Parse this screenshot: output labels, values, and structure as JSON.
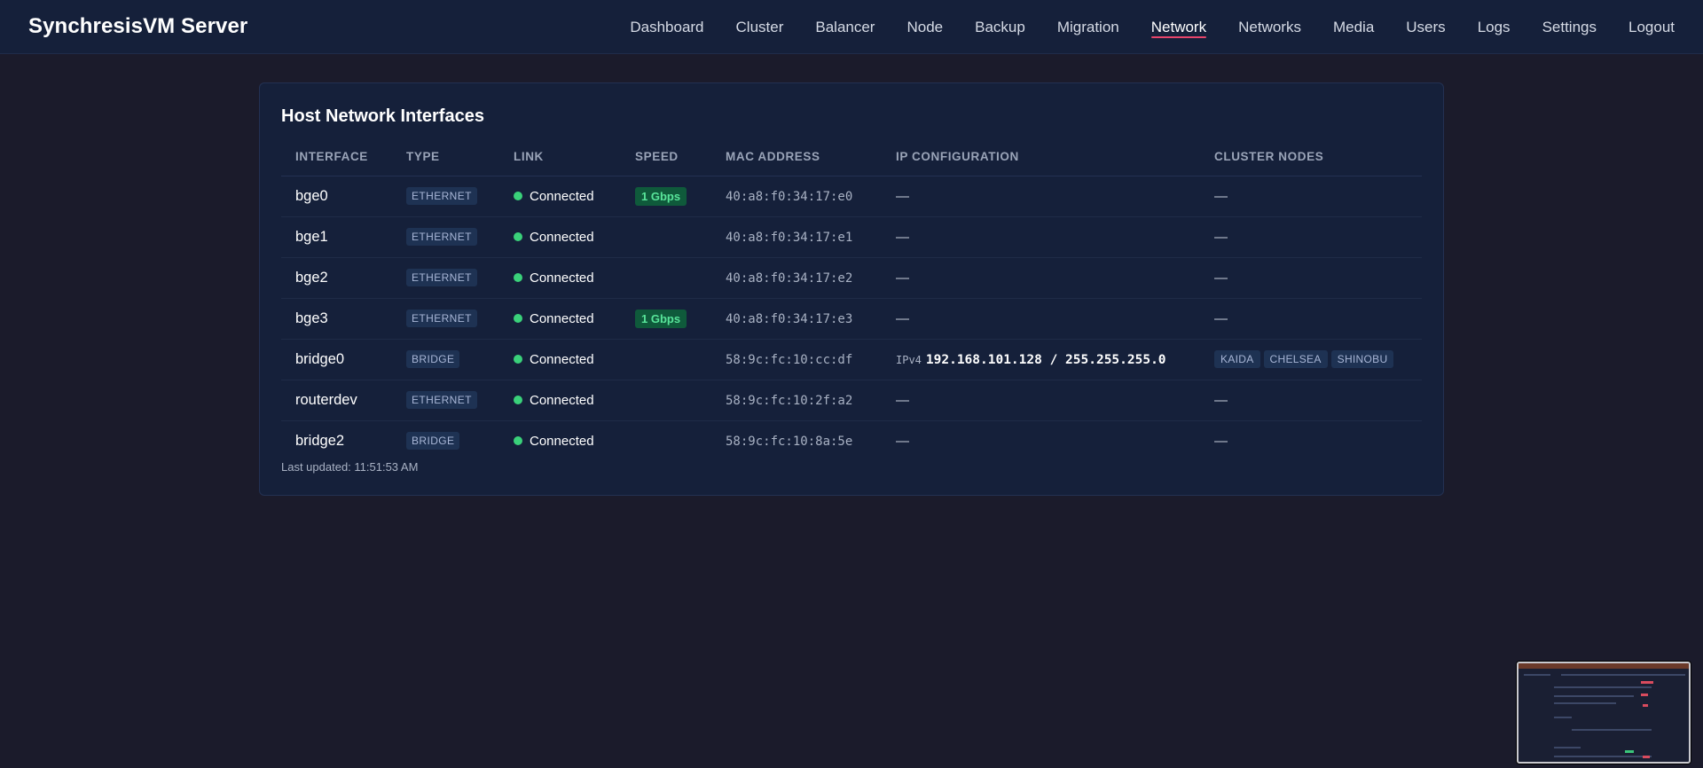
{
  "app": {
    "title": "SynchresisVM Server"
  },
  "nav": {
    "items": [
      {
        "label": "Dashboard",
        "active": false
      },
      {
        "label": "Cluster",
        "active": false
      },
      {
        "label": "Balancer",
        "active": false
      },
      {
        "label": "Node",
        "active": false
      },
      {
        "label": "Backup",
        "active": false
      },
      {
        "label": "Migration",
        "active": false
      },
      {
        "label": "Network",
        "active": true
      },
      {
        "label": "Networks",
        "active": false
      },
      {
        "label": "Media",
        "active": false
      },
      {
        "label": "Users",
        "active": false
      },
      {
        "label": "Logs",
        "active": false
      },
      {
        "label": "Settings",
        "active": false
      },
      {
        "label": "Logout",
        "active": false
      }
    ]
  },
  "card": {
    "title": "Host Network Interfaces",
    "columns": [
      "INTERFACE",
      "TYPE",
      "LINK",
      "SPEED",
      "MAC ADDRESS",
      "IP CONFIGURATION",
      "CLUSTER NODES"
    ],
    "rows": [
      {
        "interface": "bge0",
        "type": "ETHERNET",
        "link": "Connected",
        "speed": "1 Gbps",
        "mac": "40:a8:f0:34:17:e0",
        "ip_label": "",
        "ip": "—",
        "nodes": [],
        "nodes_empty": "—"
      },
      {
        "interface": "bge1",
        "type": "ETHERNET",
        "link": "Connected",
        "speed": "",
        "mac": "40:a8:f0:34:17:e1",
        "ip_label": "",
        "ip": "—",
        "nodes": [],
        "nodes_empty": "—"
      },
      {
        "interface": "bge2",
        "type": "ETHERNET",
        "link": "Connected",
        "speed": "",
        "mac": "40:a8:f0:34:17:e2",
        "ip_label": "",
        "ip": "—",
        "nodes": [],
        "nodes_empty": "—"
      },
      {
        "interface": "bge3",
        "type": "ETHERNET",
        "link": "Connected",
        "speed": "1 Gbps",
        "mac": "40:a8:f0:34:17:e3",
        "ip_label": "",
        "ip": "—",
        "nodes": [],
        "nodes_empty": "—"
      },
      {
        "interface": "bridge0",
        "type": "BRIDGE",
        "link": "Connected",
        "speed": "",
        "mac": "58:9c:fc:10:cc:df",
        "ip_label": "IPv4",
        "ip": "192.168.101.128 / 255.255.255.0",
        "nodes": [
          "KAIDA",
          "CHELSEA",
          "SHINOBU"
        ],
        "nodes_empty": ""
      },
      {
        "interface": "routerdev",
        "type": "ETHERNET",
        "link": "Connected",
        "speed": "",
        "mac": "58:9c:fc:10:2f:a2",
        "ip_label": "",
        "ip": "—",
        "nodes": [],
        "nodes_empty": "—"
      },
      {
        "interface": "bridge2",
        "type": "BRIDGE",
        "link": "Connected",
        "speed": "",
        "mac": "58:9c:fc:10:8a:5e",
        "ip_label": "",
        "ip": "—",
        "nodes": [],
        "nodes_empty": "—"
      }
    ],
    "last_updated": "Last updated: 11:51:53 AM"
  },
  "colors": {
    "nav_active_underline": "#e8456b",
    "link_connected": "#3ad17a",
    "speed_badge_bg": "#0f5a3b"
  },
  "icons": {
    "link_status": "status-dot-icon"
  }
}
